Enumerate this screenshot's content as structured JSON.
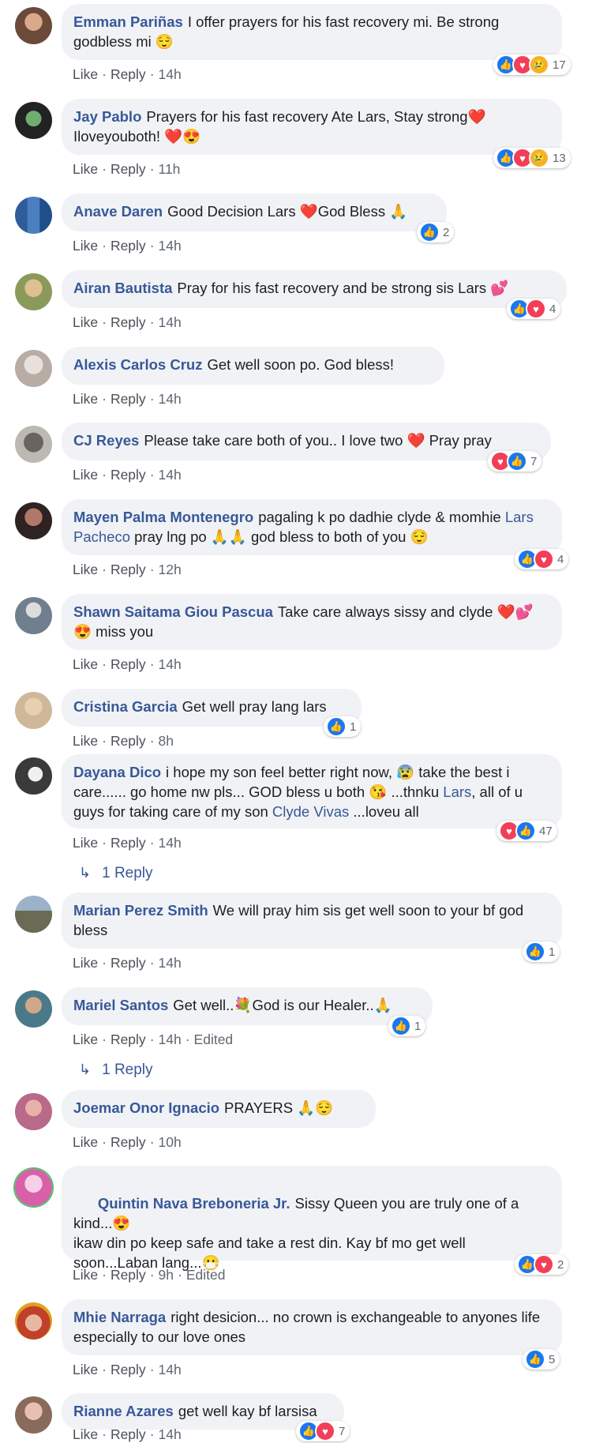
{
  "ui": {
    "like_label": "Like",
    "reply_label": "Reply",
    "sep": "·",
    "reply_arrow": "↳"
  },
  "comments": [
    {
      "author": "Emman Pariñas",
      "text": "I offer prayers for his fast recovery mi. Be strong godbless mi 😌",
      "time": "14h",
      "edited": "",
      "reactions": [
        "like",
        "love",
        "sad"
      ],
      "count": "17",
      "avatar_color": "#6b4a3a"
    },
    {
      "author": "Jay Pablo",
      "text": "Prayers for his fast recovery Ate Lars, Stay strong❤️ Iloveyouboth! ❤️😍",
      "time": "11h",
      "edited": "",
      "reactions": [
        "like",
        "love",
        "sad"
      ],
      "count": "13",
      "avatar_color": "#2b2b2b"
    },
    {
      "author": "Anave Daren",
      "text": "Good Decision Lars ❤️God Bless 🙏",
      "time": "14h",
      "edited": "",
      "reactions": [
        "like"
      ],
      "count": "2",
      "avatar_color": "#3f6da8"
    },
    {
      "author": "Airan Bautista",
      "text": "Pray for his fast recovery and be strong sis Lars 💕",
      "time": "14h",
      "edited": "",
      "reactions": [
        "like",
        "love"
      ],
      "count": "4",
      "avatar_color": "#a88a4a"
    },
    {
      "author": "Alexis Carlos Cruz",
      "text": "Get well soon po. God bless!",
      "time": "14h",
      "edited": "",
      "reactions": [],
      "count": "",
      "avatar_color": "#c9c1bb"
    },
    {
      "author": "CJ Reyes",
      "text": "Please take care both of you.. I love two ❤️ Pray pray",
      "time": "14h",
      "edited": "",
      "reactions": [
        "love",
        "like"
      ],
      "count": "7",
      "avatar_color": "#4d4a48"
    },
    {
      "author": "Mayen Palma Montenegro",
      "text_pre": "pagaling k po dadhie clyde & momhie ",
      "mention": "Lars Pacheco",
      "text_post": " pray lng po 🙏🙏 god bless to both of you 😌",
      "time": "12h",
      "edited": "",
      "reactions": [
        "like",
        "love"
      ],
      "count": "4",
      "avatar_color": "#3a2b2b"
    },
    {
      "author": "Shawn Saitama Giou Pascua",
      "text": "Take care always sissy and clyde ❤️💕😍 miss you",
      "time": "14h",
      "edited": "",
      "reactions": [],
      "count": "",
      "avatar_color": "#7a8a9a"
    },
    {
      "author": "Cristina Garcia",
      "text": "Get well pray lang lars",
      "time": "8h",
      "edited": "",
      "reactions": [
        "like"
      ],
      "count": "1",
      "avatar_color": "#d8c3a8"
    },
    {
      "author": "Dayana Dico",
      "text_pre": "i hope my son feel better right now, 😰 take the best i care...... go home nw pls... GOD bless u both 😘 ...thnku ",
      "mention": "Lars",
      "text_mid": ", all of u guys for taking care of my son ",
      "mention2": "Clyde Vivas",
      "text_post": " ...loveu all",
      "time": "14h",
      "edited": "",
      "reactions": [
        "love",
        "like"
      ],
      "count": "47",
      "avatar_color": "#3a3a3a",
      "replies": "1 Reply"
    },
    {
      "author": "Marian Perez Smith",
      "text": "We will pray him sis get well soon to your bf god bless",
      "time": "14h",
      "edited": "",
      "reactions": [
        "like"
      ],
      "count": "1",
      "avatar_color": "#6a6a55"
    },
    {
      "author": "Mariel Santos",
      "text": "Get well..💐God is our Healer..🙏",
      "time": "14h",
      "edited": "Edited",
      "reactions": [
        "like"
      ],
      "count": "1",
      "avatar_color": "#4a7a8a",
      "replies": "1 Reply"
    },
    {
      "author": "Joemar Onor Ignacio",
      "text": "PRAYERS 🙏😌",
      "time": "10h",
      "edited": "",
      "reactions": [],
      "count": "",
      "avatar_color": "#c88aa0"
    },
    {
      "author": "Quintin Nava Breboneria Jr.",
      "text": "Sissy Queen you are truly one of a kind...😍\nikaw din po keep safe and take a rest din. Kay bf mo get well soon...Laban lang...😷",
      "time": "9h",
      "edited": "Edited",
      "reactions": [
        "like",
        "love"
      ],
      "count": "2",
      "avatar_color": "#d860a8"
    },
    {
      "author": "Mhie Narraga",
      "text": "right desicion... no crown is exchangeable to anyones life especially to our love ones",
      "time": "14h",
      "edited": "",
      "reactions": [
        "like"
      ],
      "count": "5",
      "avatar_color": "#c0402a"
    },
    {
      "author": "Rianne Azares",
      "text": "get well kay bf larsisa",
      "time": "14h",
      "edited": "",
      "reactions": [
        "like",
        "love"
      ],
      "count": "7",
      "avatar_color": "#8a6a5a"
    }
  ]
}
